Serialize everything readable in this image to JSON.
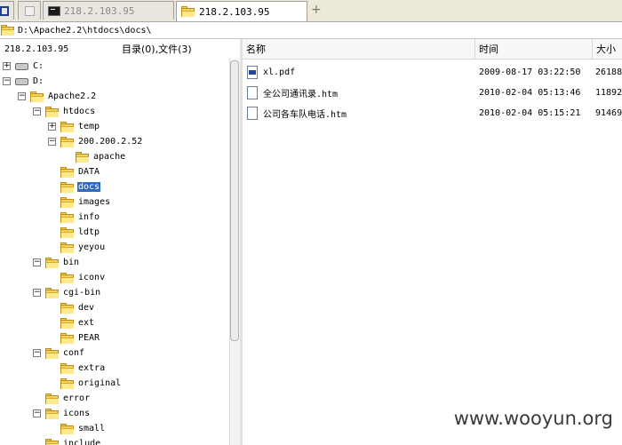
{
  "tabs": [
    {
      "label": "",
      "icon": "window-icon"
    },
    {
      "label": "",
      "icon": "blank-page-icon"
    },
    {
      "label": "218.2.103.95",
      "icon": "terminal-icon"
    },
    {
      "label": "218.2.103.95",
      "icon": "folder-icon",
      "active": true
    }
  ],
  "new_tab_label": "+",
  "path": "D:\\Apache2.2\\htdocs\\docs\\",
  "left_panel": {
    "host": "218.2.103.95",
    "summary": "目录(0),文件(3)"
  },
  "tree": [
    {
      "label": "C:",
      "type": "drive",
      "expander": "+"
    },
    {
      "label": "D:",
      "type": "drive",
      "expander": "-"
    },
    {
      "label": "Apache2.2",
      "expander": "-"
    },
    {
      "label": "htdocs",
      "expander": "-"
    },
    {
      "label": "temp",
      "expander": "+"
    },
    {
      "label": "200.200.2.52",
      "expander": "-"
    },
    {
      "label": "apache",
      "expander": ""
    },
    {
      "label": "DATA",
      "expander": ""
    },
    {
      "label": "docs",
      "expander": "",
      "selected": true
    },
    {
      "label": "images",
      "expander": ""
    },
    {
      "label": "info",
      "expander": ""
    },
    {
      "label": "ldtp",
      "expander": ""
    },
    {
      "label": "yeyou",
      "expander": ""
    },
    {
      "label": "bin",
      "expander": "-"
    },
    {
      "label": "iconv",
      "expander": ""
    },
    {
      "label": "cgi-bin",
      "expander": "-"
    },
    {
      "label": "dev",
      "expander": ""
    },
    {
      "label": "ext",
      "expander": ""
    },
    {
      "label": "PEAR",
      "expander": ""
    },
    {
      "label": "conf",
      "expander": "-"
    },
    {
      "label": "extra",
      "expander": ""
    },
    {
      "label": "original",
      "expander": ""
    },
    {
      "label": "error",
      "expander": ""
    },
    {
      "label": "icons",
      "expander": "-"
    },
    {
      "label": "small",
      "expander": ""
    },
    {
      "label": "include",
      "expander": ""
    }
  ],
  "columns": [
    "名称",
    "时间",
    "大小"
  ],
  "files": [
    {
      "name": "xl.pdf",
      "time": "2009-08-17 03:22:50",
      "size": "26188",
      "icon": "pdf-file-icon"
    },
    {
      "name": "全公司通讯录.htm",
      "time": "2010-02-04 05:13:46",
      "size": "11892",
      "icon": "html-file-icon"
    },
    {
      "name": "公司各车队电话.htm",
      "time": "2010-02-04 05:15:21",
      "size": "91469",
      "icon": "html-file-icon"
    }
  ],
  "watermark": "www.wooyun.org"
}
